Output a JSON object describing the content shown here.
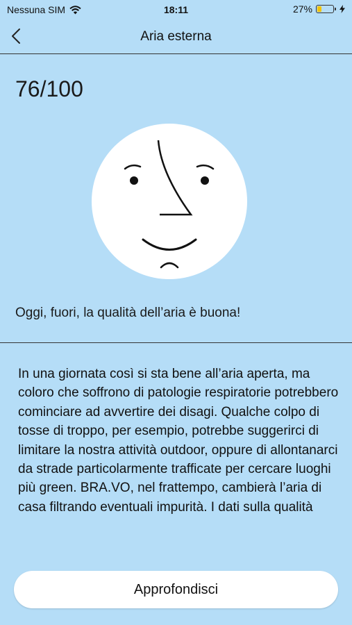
{
  "status_bar": {
    "carrier": "Nessuna SIM",
    "wifi_icon": "wifi-icon",
    "time": "18:11",
    "battery_percent": "27%",
    "battery_level": 0.27,
    "charging_icon": "bolt-icon"
  },
  "nav": {
    "back_icon": "chevron-left-icon",
    "title": "Aria esterna"
  },
  "score": "76/100",
  "face_icon": "smiling-face-icon",
  "summary": "Oggi, fuori, la qualità dell’aria è buona!",
  "description": "In una giornata così si sta bene all’aria aperta, ma coloro che soffrono di patologie respiratorie potrebbero cominciare ad avvertire dei disagi. Qualche colpo di tosse di troppo, per esempio, potrebbe suggerirci di limitare la nostra attività outdoor, oppure di allontanarci da strade particolarmente trafficate per cercare luoghi più green. BRA.VO, nel frattempo, cambierà l’aria di casa filtrando eventuali impurità. I dati sulla qualità",
  "button": {
    "label": "Approfondisci"
  },
  "colors": {
    "background": "#b5ddf7",
    "battery": "#f3c300"
  }
}
